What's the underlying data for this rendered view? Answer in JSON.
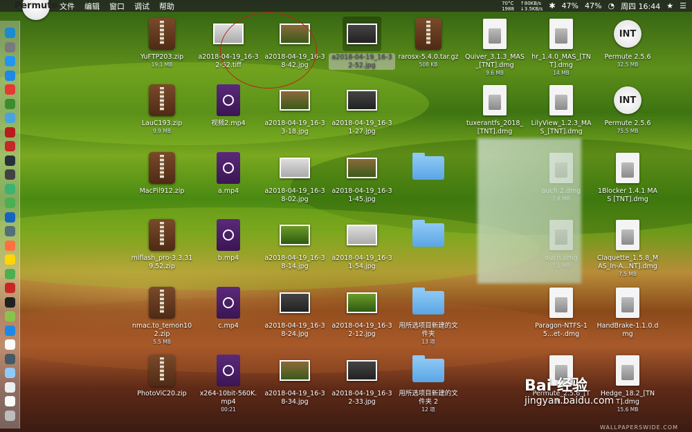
{
  "menubar": {
    "apple_icon": "apple-icon",
    "app_name": "Permute",
    "menus": [
      "文件",
      "编辑",
      "窗口",
      "调试",
      "帮助"
    ],
    "temp": "70°C",
    "fan": "1988",
    "net_up": "↑80KB/s",
    "net_down": "↓3.5KB/s",
    "datetime": "周四 16:44",
    "battery_a": "47%",
    "battery_b": "47%"
  },
  "files": [
    {
      "name": "YuFTP203.zip",
      "meta": "19.1 MB",
      "type": "zip"
    },
    {
      "name": "a2018-04-19_16-32-52.tiff",
      "meta": "",
      "type": "img"
    },
    {
      "name": "a2018-04-19_16-38-42.jpg",
      "meta": "",
      "type": "img"
    },
    {
      "name": "a2018-04-19_16-32-52.jpg",
      "meta": "",
      "type": "img",
      "selected": true
    },
    {
      "name": "rarosx-5.4.0.tar.gz",
      "meta": "508 KB",
      "type": "zip"
    },
    {
      "name": "Quiver_3.1.3_MAS_[TNT].dmg",
      "meta": "9.6 MB",
      "type": "dmg"
    },
    {
      "name": "hr_1.4.0_MAS_[TNT].dmg",
      "meta": "14 MB",
      "type": "dmg"
    },
    {
      "name": "Permute 2.5.6",
      "meta": "32.5 MB",
      "type": "app"
    },
    {
      "name": "LauC193.zip",
      "meta": "9.9 MB",
      "type": "zip"
    },
    {
      "name": "视频2.mp4",
      "meta": "",
      "type": "mp4"
    },
    {
      "name": "a2018-04-19_16-33-18.jpg",
      "meta": "",
      "type": "img"
    },
    {
      "name": "a2018-04-19_16-31-27.jpg",
      "meta": "",
      "type": "img"
    },
    {
      "name": "tuxerantfs_2018_[TNT].dmg",
      "meta": "",
      "type": "dmg"
    },
    {
      "name": "LilyView_1.2.3_MAS_[TNT].dmg",
      "meta": "",
      "type": "dmg"
    },
    {
      "name": "Permute 2.5.6",
      "meta": "75.5 MB",
      "type": "app"
    },
    {
      "name": "MacPil912.zip",
      "meta": "",
      "type": "zip"
    },
    {
      "name": "a.mp4",
      "meta": "",
      "type": "mp4"
    },
    {
      "name": "a2018-04-19_16-38-02.jpg",
      "meta": "",
      "type": "img"
    },
    {
      "name": "a2018-04-19_16-31-45.jpg",
      "meta": "",
      "type": "img"
    },
    {
      "name": "",
      "meta": "",
      "type": "folder"
    },
    {
      "name": "ouch 2.dmg",
      "meta": "7.8 MB",
      "type": "dmg"
    },
    {
      "name": "1Blocker 1.4.1 MAS [TNT].dmg",
      "meta": "",
      "type": "dmg"
    },
    {
      "name": "miflash_pro-3.3.319.52.zip",
      "meta": "",
      "type": "zip"
    },
    {
      "name": "b.mp4",
      "meta": "",
      "type": "mp4"
    },
    {
      "name": "a2018-04-19_16-38-14.jpg",
      "meta": "",
      "type": "img"
    },
    {
      "name": "a2018-04-19_16-31-54.jpg",
      "meta": "",
      "type": "img"
    },
    {
      "name": "",
      "meta": "",
      "type": "folder"
    },
    {
      "name": "ouch.dmg",
      "meta": "7.1 MB",
      "type": "dmg"
    },
    {
      "name": "Claquette_1.5.8_MAS_In-A...NT].dmg",
      "meta": "7.5 MB",
      "type": "dmg"
    },
    {
      "name": "nmac.to_temon102.zip",
      "meta": "5.5 MB",
      "type": "zip"
    },
    {
      "name": "c.mp4",
      "meta": "",
      "type": "mp4"
    },
    {
      "name": "a2018-04-19_16-38-24.jpg",
      "meta": "",
      "type": "img"
    },
    {
      "name": "a2018-04-19_16-32-12.jpg",
      "meta": "",
      "type": "img"
    },
    {
      "name": "用所选项目新建的文件夹",
      "meta": "13 项",
      "type": "folder"
    },
    {
      "name": "Paragon-NTFS-15...et-.dmg",
      "meta": "",
      "type": "dmg"
    },
    {
      "name": "HandBrake-1.1.0.dmg",
      "meta": "",
      "type": "dmg"
    },
    {
      "name": "PhotoViC20.zip",
      "meta": "",
      "type": "zip"
    },
    {
      "name": "x264-10bit-560K.mp4",
      "meta": "00:21",
      "type": "mp4"
    },
    {
      "name": "a2018-04-19_16-38-34.jpg",
      "meta": "",
      "type": "img"
    },
    {
      "name": "a2018-04-19_16-32-33.jpg",
      "meta": "",
      "type": "img"
    },
    {
      "name": "用所选项目新建的文件夹 2",
      "meta": "12 项",
      "type": "folder"
    },
    {
      "name": "Permute_2.5.6_[TN...",
      "meta": "",
      "type": "dmg"
    },
    {
      "name": "Hedge_18.2_[TNT].dmg",
      "meta": "15.6 MB",
      "type": "dmg"
    }
  ],
  "watermark": {
    "main": "Bai 经验",
    "url": "jingyan.baidu.com"
  },
  "credit": "WALLPAPERSWIDE.COM",
  "colors": {
    "highlight_ring": "#c0201a",
    "folder": "#5aa5e6"
  }
}
